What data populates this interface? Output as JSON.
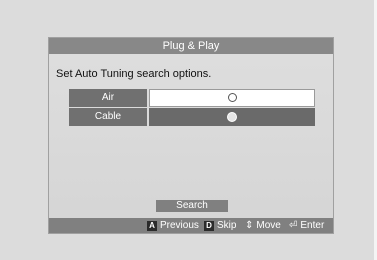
{
  "dialog": {
    "title": "Plug & Play",
    "instruction": "Set Auto Tuning search options.",
    "options": [
      {
        "label": "Air",
        "selected": false,
        "focused": true
      },
      {
        "label": "Cable",
        "selected": true,
        "focused": false
      }
    ],
    "search_label": "Search"
  },
  "footer": {
    "previous": {
      "key": "A",
      "label": "Previous"
    },
    "skip": {
      "key": "D",
      "label": "Skip"
    },
    "move": {
      "icon": "up-down-arrows-icon",
      "label": "Move"
    },
    "enter": {
      "icon": "enter-icon",
      "label": "Enter"
    }
  }
}
